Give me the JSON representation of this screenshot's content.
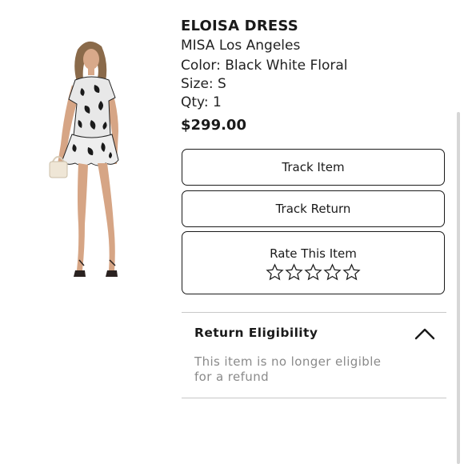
{
  "product": {
    "name": "ELOISA DRESS",
    "brand": "MISA Los Angeles",
    "color": "Color: Black White Floral",
    "size": "Size: S",
    "qty": "Qty: 1",
    "price": "$299.00"
  },
  "actions": {
    "track_item_label": "Track Item",
    "track_return_label": "Track Return",
    "rate_item_label": "Rate This Item",
    "rating": 0,
    "rating_max": 5
  },
  "eligibility": {
    "title": "Return Eligibility",
    "message": "This item is no longer eligible for a refund",
    "expanded": true
  },
  "colors": {
    "text": "#1a1a1a",
    "muted_text": "#8a8a8a",
    "divider": "#c8c8c8"
  },
  "icons": {
    "collapse": "chevron-up-icon",
    "rating": "star-outline-icon"
  }
}
